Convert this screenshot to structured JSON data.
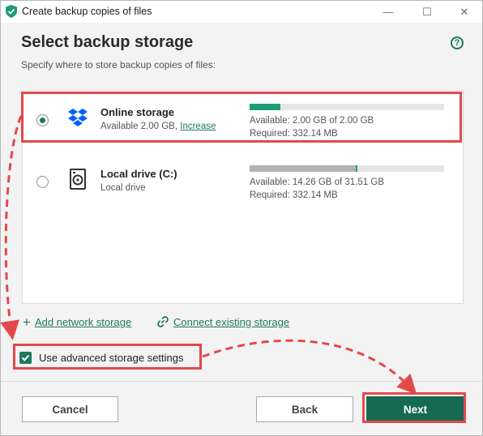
{
  "window": {
    "title": "Create backup copies of files",
    "controls": [
      "—",
      "☐",
      "✕"
    ]
  },
  "header": {
    "title": "Select backup storage",
    "help_icon": "?",
    "subtitle": "Specify where to store backup copies of files:"
  },
  "storages": [
    {
      "name": "Online storage",
      "detail": "Available 2.00 GB,",
      "link": "Increase",
      "icon": "dropbox-icon",
      "selected": true,
      "available": "Available: 2.00 GB of 2.00 GB",
      "required": "Required: 332.14 MB",
      "usage_fraction": 0.16,
      "bar_color": "#1f9c77"
    },
    {
      "name": "Local drive (C:)",
      "detail": "Local drive",
      "icon": "hard-drive-icon",
      "selected": false,
      "available": "Available: 14.26 GB of 31.51 GB",
      "required": "Required: 332.14 MB",
      "usage_fraction": 0.547,
      "bar_color": "#b3b3b3"
    }
  ],
  "links": {
    "add_network": "Add network storage",
    "connect_existing": "Connect existing storage",
    "add_glyph": "+",
    "connect_glyph": "🔗"
  },
  "advanced": {
    "label": "Use advanced storage settings",
    "checked": true
  },
  "buttons": {
    "cancel": "Cancel",
    "back": "Back",
    "next": "Next"
  },
  "colors": {
    "accent": "#1f7a5e",
    "annotation": "#e2494b",
    "next_button": "#176a52"
  }
}
